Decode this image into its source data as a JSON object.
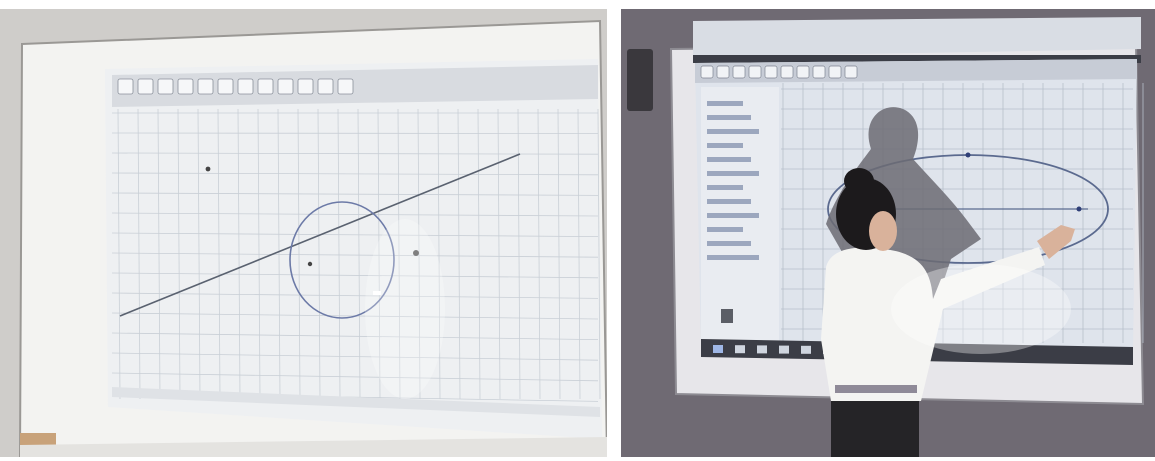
{
  "photos": [
    {
      "id": "left",
      "scene": "projected-geometry-board",
      "background_wall": "#cfcdca",
      "board_frame": "#f3f3f1",
      "projection_bg": "#eef0f2",
      "toolbar_bg": "#d8dbe0",
      "grid_color": "#c9cfd6",
      "circle_color": "#6c7aa7",
      "line_color": "#5a6270",
      "circle": {
        "cx": 1.6,
        "cy": 0.2,
        "r": 2.4
      },
      "line": {
        "x1": -9.5,
        "y1": -2.6,
        "x2": 10.5,
        "y2": 5.5
      },
      "toolbar_icons": [
        "move-icon",
        "point-icon",
        "line-icon",
        "perpendicular-icon",
        "polygon-icon",
        "circle-icon",
        "ellipse-icon",
        "angle-icon",
        "reflect-icon",
        "slider-icon",
        "text-icon",
        "zoom-icon"
      ]
    },
    {
      "id": "right",
      "scene": "student-at-interactive-board",
      "background_wall": "#6f6a73",
      "board_frame": "#e7e6ea",
      "projection_bg": "#dfe4ec",
      "toolbar_bg": "#c7ccd6",
      "grid_color": "#b7bfcb",
      "ellipse_color": "#5b6a8f",
      "taskbar_bg": "#3b3d46",
      "shadow_color": "#6c6b73",
      "student_shirt": "#f4f4f2",
      "student_hair": "#1c1a1c",
      "student_skin": "#d9b29b",
      "student_pants": "#252427",
      "ellipse": {
        "cx": 3.0,
        "cy": 0.0,
        "rx": 3.0,
        "ry": 1.6
      },
      "toolbar_icons": [
        "move-icon",
        "point-icon",
        "line-icon",
        "perpendicular-icon",
        "polygon-icon",
        "circle-icon",
        "ellipse-icon",
        "angle-icon",
        "reflect-icon",
        "slider-icon"
      ],
      "taskbar_icons": [
        "start-icon",
        "search-icon",
        "taskview-icon",
        "browser-icon",
        "folder-icon",
        "store-icon",
        "mail-icon",
        "geogebra-icon",
        "media-icon",
        "app-icon"
      ]
    }
  ]
}
